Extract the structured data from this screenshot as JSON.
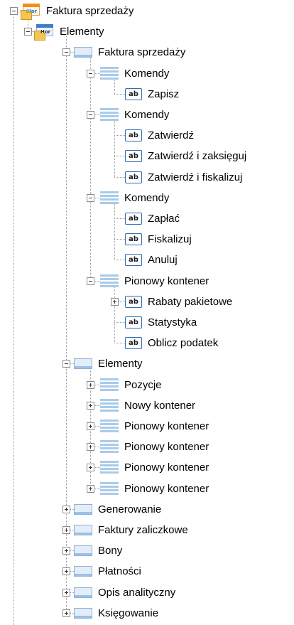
{
  "tree": {
    "items": [
      {
        "depth": 0,
        "type": "form-orange",
        "toggle": "expanded",
        "label": "Faktura sprzedaży",
        "icon_name": "form-icon"
      },
      {
        "depth": 1,
        "type": "form",
        "toggle": "expanded",
        "label": "Elementy",
        "icon_name": "form-icon"
      },
      {
        "depth": 2,
        "type": "container",
        "toggle": "expanded",
        "label": "Faktura sprzedaży",
        "icon_name": "container-icon"
      },
      {
        "depth": 3,
        "type": "commands",
        "toggle": "expanded",
        "label": "Komendy",
        "icon_name": "commands-icon"
      },
      {
        "depth": 4,
        "type": "ab",
        "toggle": "none",
        "label": "Zapisz",
        "icon_name": "textbox-icon",
        "icon_text": "ab"
      },
      {
        "depth": 3,
        "type": "commands",
        "toggle": "expanded",
        "label": "Komendy",
        "icon_name": "commands-icon"
      },
      {
        "depth": 4,
        "type": "ab",
        "toggle": "none",
        "label": "Zatwierdź",
        "icon_name": "textbox-icon",
        "icon_text": "ab"
      },
      {
        "depth": 4,
        "type": "ab",
        "toggle": "none",
        "label": "Zatwierdź i zaksięguj",
        "icon_name": "textbox-icon",
        "icon_text": "ab"
      },
      {
        "depth": 4,
        "type": "ab",
        "toggle": "none",
        "label": "Zatwierdź i fiskalizuj",
        "icon_name": "textbox-icon",
        "icon_text": "ab"
      },
      {
        "depth": 3,
        "type": "commands",
        "toggle": "expanded",
        "label": "Komendy",
        "icon_name": "commands-icon"
      },
      {
        "depth": 4,
        "type": "ab",
        "toggle": "none",
        "label": "Zapłać",
        "icon_name": "textbox-icon",
        "icon_text": "ab"
      },
      {
        "depth": 4,
        "type": "ab",
        "toggle": "none",
        "label": "Fiskalizuj",
        "icon_name": "textbox-icon",
        "icon_text": "ab"
      },
      {
        "depth": 4,
        "type": "ab",
        "toggle": "none",
        "label": "Anuluj",
        "icon_name": "textbox-icon",
        "icon_text": "ab"
      },
      {
        "depth": 3,
        "type": "commands",
        "toggle": "expanded",
        "label": "Pionowy kontener",
        "icon_name": "commands-icon"
      },
      {
        "depth": 4,
        "type": "ab",
        "toggle": "collapsed",
        "label": "Rabaty pakietowe",
        "icon_name": "textbox-icon",
        "icon_text": "ab"
      },
      {
        "depth": 4,
        "type": "ab",
        "toggle": "none",
        "label": "Statystyka",
        "icon_name": "textbox-icon",
        "icon_text": "ab"
      },
      {
        "depth": 4,
        "type": "ab",
        "toggle": "none",
        "label": "Oblicz podatek",
        "icon_name": "textbox-icon",
        "icon_text": "ab"
      },
      {
        "depth": 2,
        "type": "container",
        "toggle": "expanded",
        "label": "Elementy",
        "icon_name": "container-icon"
      },
      {
        "depth": 3,
        "type": "commands",
        "toggle": "collapsed",
        "label": "Pozycje",
        "icon_name": "commands-icon"
      },
      {
        "depth": 3,
        "type": "commands",
        "toggle": "collapsed",
        "label": "Nowy kontener",
        "icon_name": "commands-icon"
      },
      {
        "depth": 3,
        "type": "commands",
        "toggle": "collapsed",
        "label": "Pionowy kontener",
        "icon_name": "commands-icon"
      },
      {
        "depth": 3,
        "type": "commands",
        "toggle": "collapsed",
        "label": "Pionowy kontener",
        "icon_name": "commands-icon"
      },
      {
        "depth": 3,
        "type": "commands",
        "toggle": "collapsed",
        "label": "Pionowy kontener",
        "icon_name": "commands-icon"
      },
      {
        "depth": 3,
        "type": "commands",
        "toggle": "collapsed",
        "label": "Pionowy kontener",
        "icon_name": "commands-icon"
      },
      {
        "depth": 2,
        "type": "container",
        "toggle": "collapsed",
        "label": "Generowanie",
        "icon_name": "container-icon"
      },
      {
        "depth": 2,
        "type": "container",
        "toggle": "collapsed",
        "label": "Faktury zaliczkowe",
        "icon_name": "container-icon"
      },
      {
        "depth": 2,
        "type": "container",
        "toggle": "collapsed",
        "label": "Bony",
        "icon_name": "container-icon"
      },
      {
        "depth": 2,
        "type": "container",
        "toggle": "collapsed",
        "label": "Płatności",
        "icon_name": "container-icon"
      },
      {
        "depth": 2,
        "type": "container",
        "toggle": "collapsed",
        "label": "Opis analityczny",
        "icon_name": "container-icon"
      },
      {
        "depth": 2,
        "type": "container",
        "toggle": "collapsed",
        "label": "Księgowanie",
        "icon_name": "container-icon"
      }
    ]
  },
  "colors": {
    "background": "#ffffff",
    "tree_lines": "#9a9a9a",
    "icon_blue": "#3d7cc9",
    "icon_orange": "#f28c1b",
    "ab_border": "#2f6db5"
  }
}
